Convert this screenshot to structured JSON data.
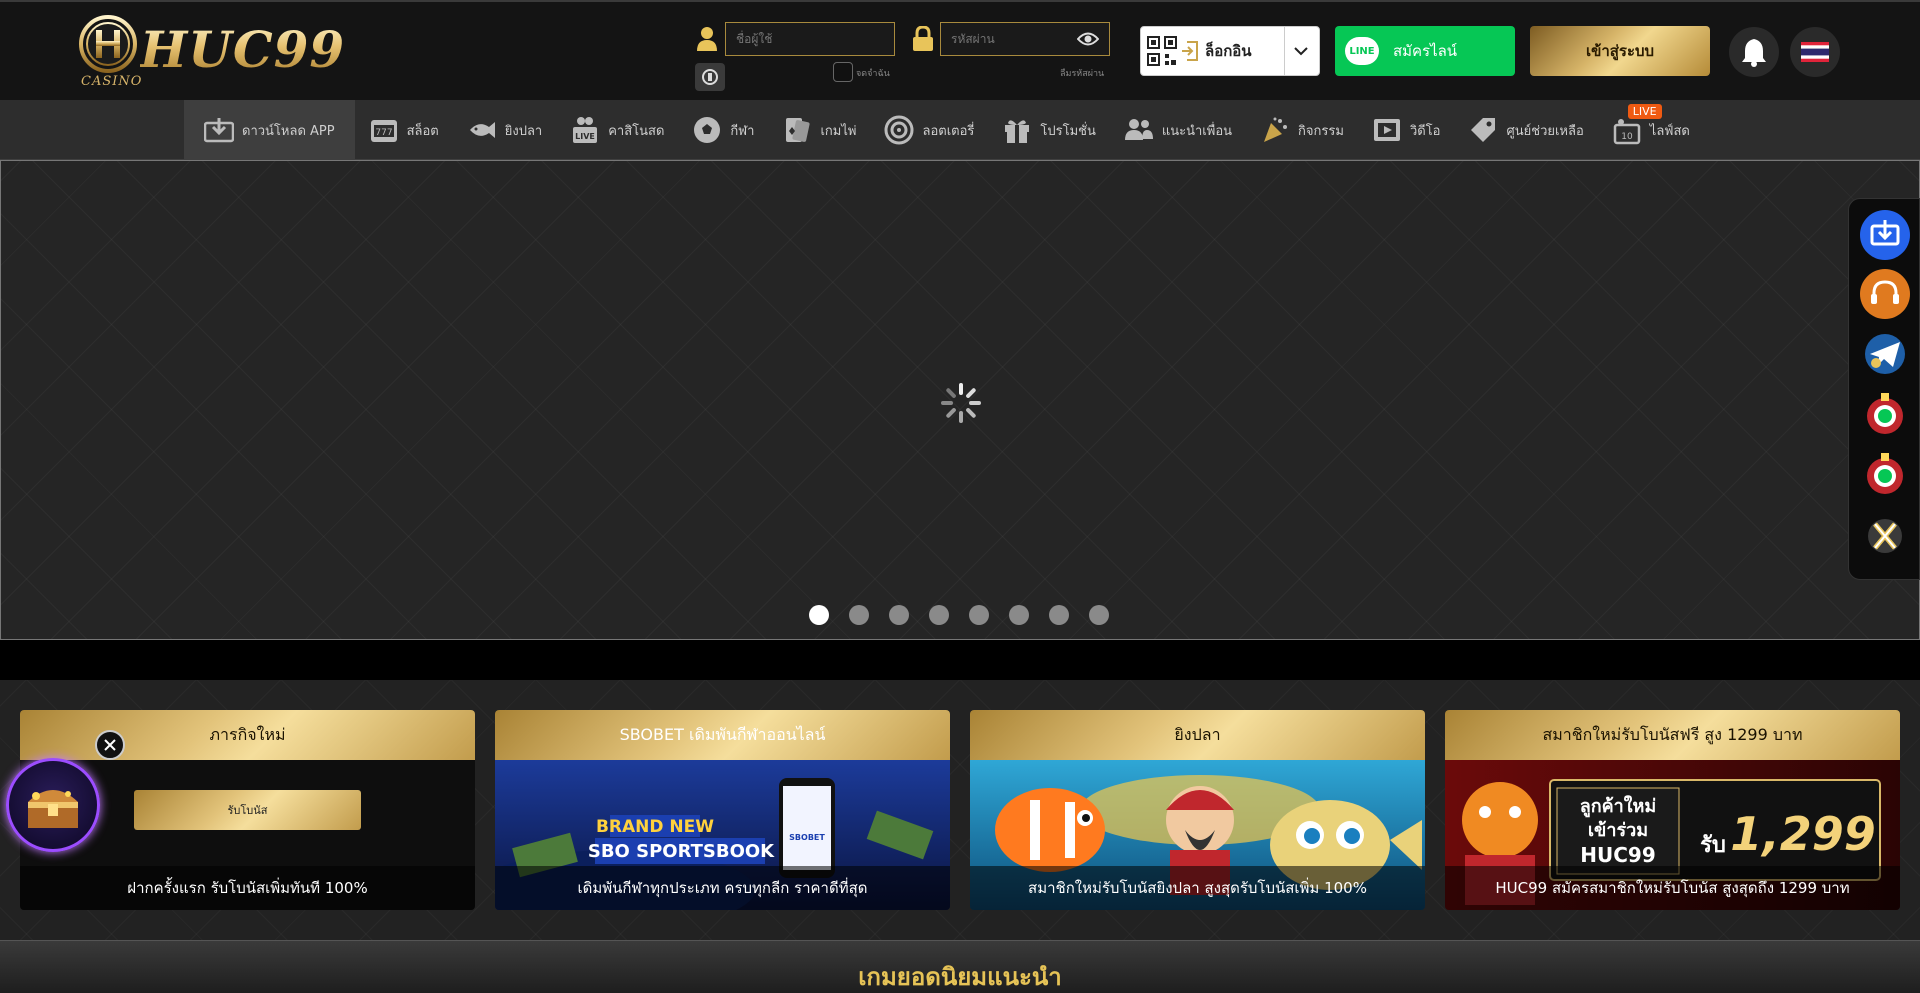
{
  "header": {
    "logo_text": "HUC99",
    "logo_subtext": "CASINO",
    "username_placeholder": "ชื่อผู้ใช้",
    "password_placeholder": "รหัสผ่าน",
    "remember_label": "จดจำฉัน",
    "forgot_label": "ลืมรหัสผ่าน",
    "app_login_label": "ล็อกอิน",
    "line_button_label": "สมัครไลน์",
    "login_button_label": "เข้าสู่ระบบ"
  },
  "nav": {
    "items": [
      {
        "label": "ดาวน์โหลด APP",
        "icon": "download-icon"
      },
      {
        "label": "สล็อต",
        "icon": "slot-777-icon"
      },
      {
        "label": "ยิงปลา",
        "icon": "fish-icon"
      },
      {
        "label": "คาสิโนสด",
        "icon": "live-casino-icon"
      },
      {
        "label": "กีฬา",
        "icon": "soccer-ball-icon"
      },
      {
        "label": "เกมไพ่",
        "icon": "cards-icon"
      },
      {
        "label": "ลอตเตอรี่",
        "icon": "lottery-icon"
      },
      {
        "label": "โปรโมชั่น",
        "icon": "gift-icon"
      },
      {
        "label": "แนะนำเพื่อน",
        "icon": "friends-icon"
      },
      {
        "label": "กิจกรรม",
        "icon": "party-icon"
      },
      {
        "label": "วิดีโอ",
        "icon": "video-icon"
      },
      {
        "label": "ศูนย์ช่วยเหลือ",
        "icon": "help-tag-icon"
      },
      {
        "label": "ไลฟ์สด",
        "icon": "live-stream-icon",
        "badge": "LIVE"
      }
    ]
  },
  "banner": {
    "slide_count": 8,
    "active_slide": 1
  },
  "promos": [
    {
      "title": "ภารกิจใหม่",
      "button": "รับโบนัส",
      "caption": "ฝากครั้งแรก รับโบนัสเพิ่มทันที 100%"
    },
    {
      "title": "SBOBET เดิมพันกีฬาออนไลน์",
      "image_text_1": "BRAND NEW",
      "image_text_2": "SBO SPORTSBOOK",
      "phone_text": "SBOBET",
      "caption": "เดิมพันกีฬาทุกประเภท ครบทุกลีก ราคาดีที่สุด"
    },
    {
      "title": "ยิงปลา",
      "caption": "สมาชิกใหม่รับโบนัสยิงปลา สูงสุดรับโบนัสเพิ่ม 100%"
    },
    {
      "title": "สมาชิกใหม่รับโบนัสฟรี สูง 1299 บาท",
      "image_text_1": "ลูกค้าใหม่",
      "image_text_2": "เข้าร่วม",
      "image_text_3": "HUC99",
      "image_text_4": "รับ",
      "image_text_5": "1,299",
      "caption": "HUC99 สมัครสมาชิกใหม่รับโบนัส สูงสุดถึง 1299 บาท"
    }
  ],
  "section": {
    "title": "เกมยอดนิยมแนะนำ"
  },
  "colors": {
    "gold": "#e2c37a",
    "line_green": "#06c755",
    "live_orange": "#ef5a12",
    "header_bg": "#141414"
  },
  "side_bar_icons": [
    "download-app-icon",
    "customer-service-icon",
    "telegram-icon",
    "line-gift-icon-1",
    "line-gift-icon-2",
    "x-twitter-icon"
  ]
}
